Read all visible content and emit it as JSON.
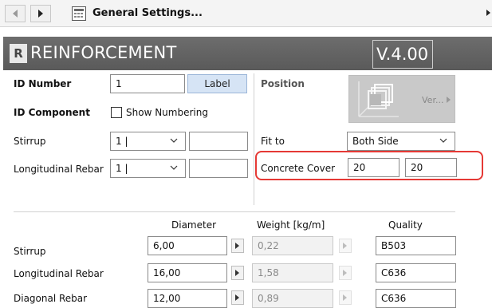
{
  "nav": {
    "title": "General Settings..."
  },
  "header": {
    "brand_logo": "R",
    "brand": "REINFORCEMENT",
    "version": "V.4.00"
  },
  "left_panel": {
    "id_number_label": "ID Number",
    "id_number_value": "1",
    "label_button": "Label",
    "id_component_label": "ID Component",
    "show_numbering_label": "Show Numbering",
    "stirrup_label": "Stirrup",
    "stirrup_select": "1 |",
    "longitudinal_label": "Longitudinal Rebar",
    "longitudinal_select": "1 |"
  },
  "right_panel": {
    "position_label": "Position",
    "preview_button": "Ver...",
    "fit_to_label": "Fit to",
    "fit_to_value": "Both Side",
    "concrete_cover_label": "Concrete Cover",
    "concrete_cover_1": "20",
    "concrete_cover_2": "20"
  },
  "table": {
    "columns": [
      "Diameter",
      "Weight [kg/m]",
      "Quality"
    ],
    "rows": [
      {
        "name": "Stirrup",
        "diameter": "6,00",
        "weight": "0,22",
        "quality": "B503"
      },
      {
        "name": "Longitudinal Rebar",
        "diameter": "16,00",
        "weight": "1,58",
        "quality": "C636"
      },
      {
        "name": "Diagonal Rebar",
        "diameter": "12,00",
        "weight": "0,89",
        "quality": "C636"
      }
    ]
  },
  "colors": {
    "banner": "#5f5f5f",
    "label_button": "#d6e4f5",
    "highlight": "#e53935"
  },
  "icons": [
    "back-arrow-icon",
    "forward-arrow-icon",
    "settings-grid-icon",
    "chevron-down-icon",
    "play-icon",
    "rebar-preview-icon"
  ]
}
